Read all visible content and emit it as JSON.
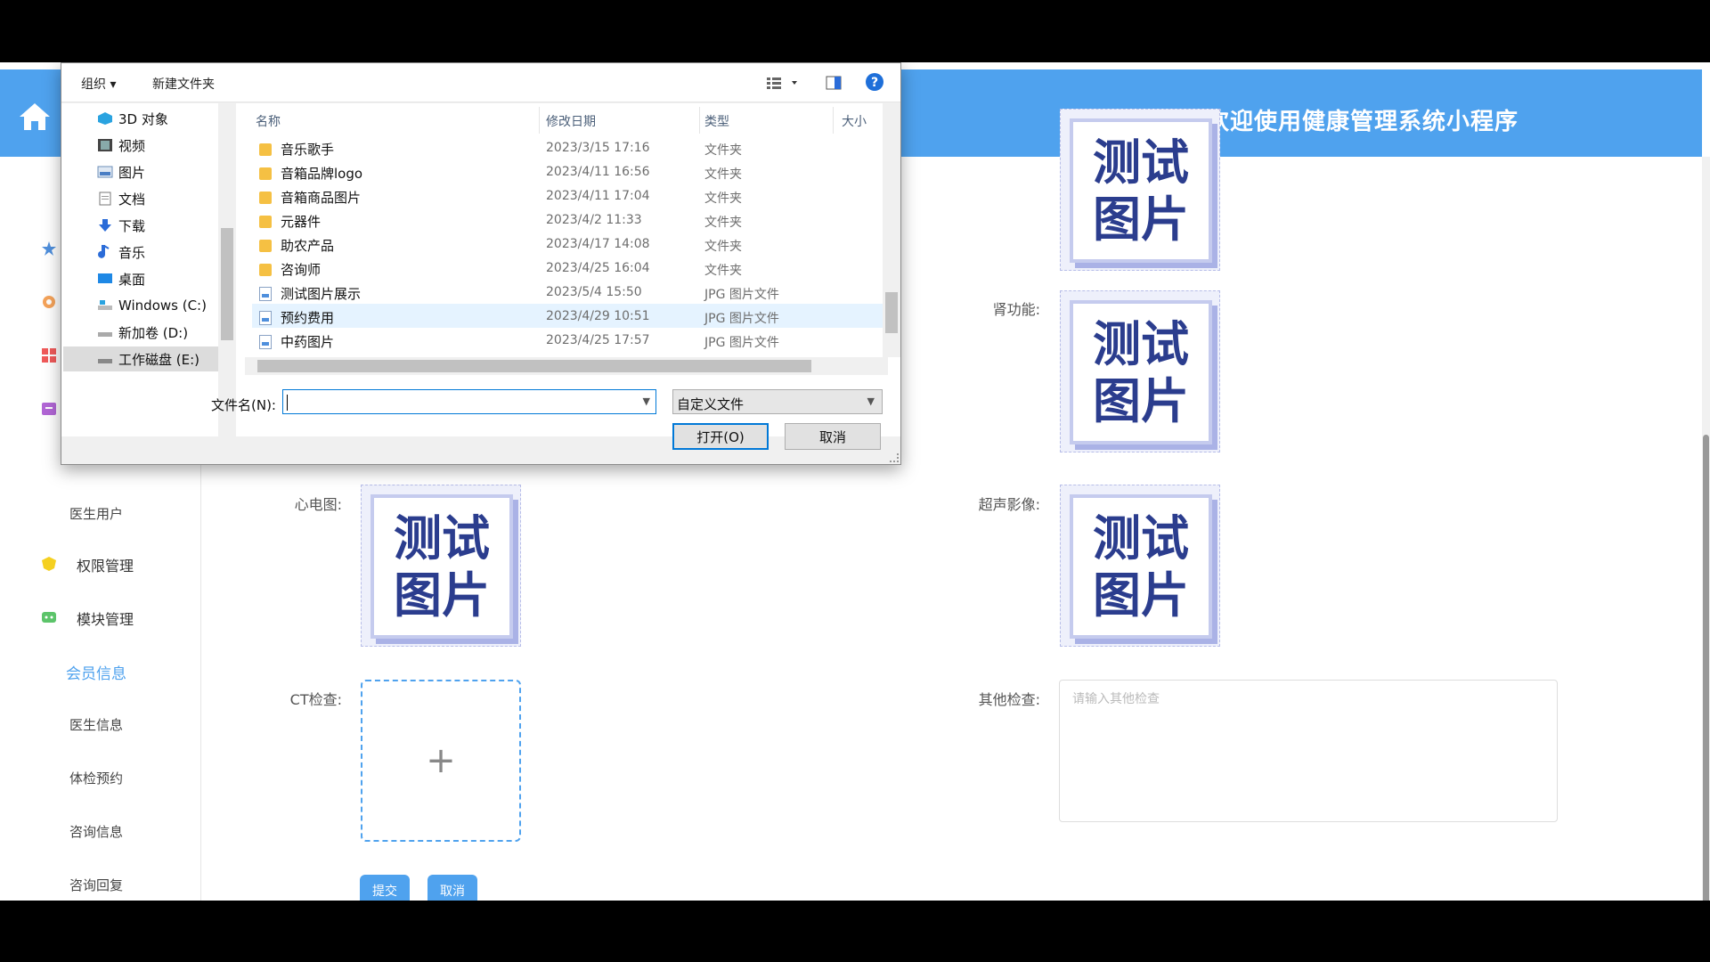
{
  "app": {
    "title": "欢迎使用健康管理系统小程序"
  },
  "sidebar": {
    "items": [
      {
        "label": "医生用户"
      },
      {
        "label": "权限管理"
      },
      {
        "label": "模块管理"
      },
      {
        "label": "会员信息"
      },
      {
        "label": "医生信息"
      },
      {
        "label": "体检预约"
      },
      {
        "label": "咨询信息"
      },
      {
        "label": "咨询回复"
      }
    ]
  },
  "form": {
    "labels": {
      "kidney": "肾功能:",
      "ecg": "心电图:",
      "ultrasound": "超声影像:",
      "ct": "CT检查:",
      "other": "其他检查:"
    },
    "image_text": [
      "测试",
      "图片"
    ],
    "other_placeholder": "请输入其他检查",
    "submit": "提交",
    "cancel": "取消"
  },
  "dialog": {
    "toolbar": {
      "organize": "组织 ▾",
      "new_folder": "新建文件夹"
    },
    "nav": [
      {
        "label": "3D 对象",
        "icon": "cube-icon"
      },
      {
        "label": "视频",
        "icon": "video-icon"
      },
      {
        "label": "图片",
        "icon": "picture-icon"
      },
      {
        "label": "文档",
        "icon": "document-icon"
      },
      {
        "label": "下载",
        "icon": "download-icon"
      },
      {
        "label": "音乐",
        "icon": "music-icon"
      },
      {
        "label": "桌面",
        "icon": "desktop-icon"
      },
      {
        "label": "Windows (C:)",
        "icon": "drive-icon"
      },
      {
        "label": "新加卷 (D:)",
        "icon": "drive-icon"
      },
      {
        "label": "工作磁盘 (E:)",
        "icon": "drive-icon"
      }
    ],
    "columns": {
      "name": "名称",
      "date": "修改日期",
      "type": "类型",
      "size": "大小"
    },
    "files": [
      {
        "name": "音乐歌手",
        "date": "2023/3/15 17:16",
        "type": "文件夹",
        "kind": "folder"
      },
      {
        "name": "音箱品牌logo",
        "date": "2023/4/11 16:56",
        "type": "文件夹",
        "kind": "folder"
      },
      {
        "name": "音箱商品图片",
        "date": "2023/4/11 17:04",
        "type": "文件夹",
        "kind": "folder"
      },
      {
        "name": "元器件",
        "date": "2023/4/2 11:33",
        "type": "文件夹",
        "kind": "folder"
      },
      {
        "name": "助农产品",
        "date": "2023/4/17 14:08",
        "type": "文件夹",
        "kind": "folder"
      },
      {
        "name": "咨询师",
        "date": "2023/4/25 16:04",
        "type": "文件夹",
        "kind": "folder"
      },
      {
        "name": "测试图片展示",
        "date": "2023/5/4 15:50",
        "type": "JPG 图片文件",
        "kind": "jpg"
      },
      {
        "name": "预约费用",
        "date": "2023/4/29 10:51",
        "type": "JPG 图片文件",
        "kind": "jpg"
      },
      {
        "name": "中药图片",
        "date": "2023/4/25 17:57",
        "type": "JPG 图片文件",
        "kind": "jpg"
      }
    ],
    "filename_label": "文件名(N):",
    "filename_value": "",
    "filetype": "自定义文件",
    "open": "打开(O)",
    "cancel": "取消"
  }
}
